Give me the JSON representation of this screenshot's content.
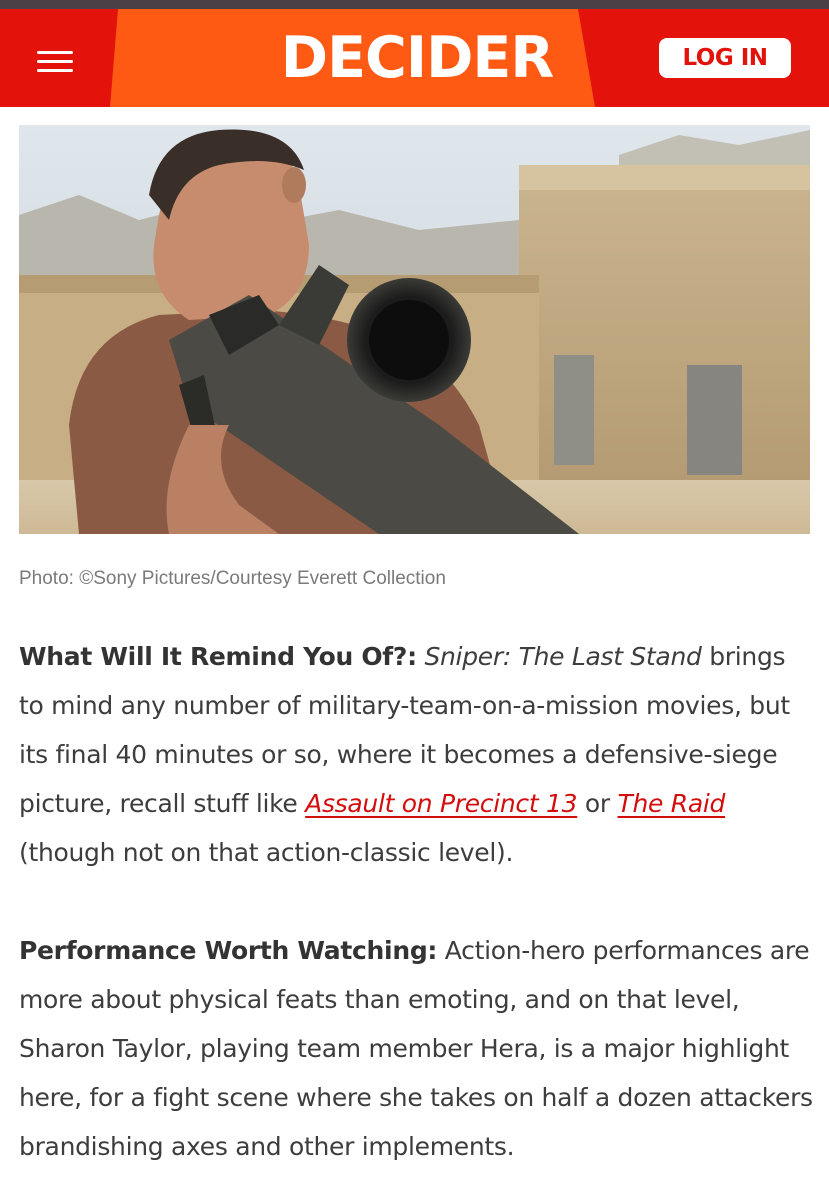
{
  "header": {
    "logo_text": "DECIDER",
    "login_label": "LOG IN",
    "menu_icon": "hamburger-menu-icon",
    "colors": {
      "primary": "#e3120b",
      "band": "#ff5a14"
    }
  },
  "hero": {
    "alt": "Man aiming a sniper rifle toward the camera in front of a tan building"
  },
  "caption": "Photo: ©Sony Pictures/Courtesy Everett Collection",
  "article": {
    "p1": {
      "label": "What Will It Remind You Of?:",
      "title": "Sniper: The Last Stand",
      "text1": " brings to mind any number of military-team-on-a-mission movies, but its final 40 minutes or so, where it becomes a defensive-siege picture, recall stuff like ",
      "link1": "Assault on Precinct 13",
      "text2": " or ",
      "link2": "The Raid",
      "text3": " (though not on that action-classic level)."
    },
    "p2": {
      "label": "Performance Worth Watching:",
      "text": " Action-hero performances are more about physical feats than emoting, and on that level, Sharon Taylor, playing team member Hera, is a major highlight here, for a fight scene where she takes on half a dozen attackers brandishing axes and other implements."
    },
    "link_color": "#d40d0d"
  }
}
